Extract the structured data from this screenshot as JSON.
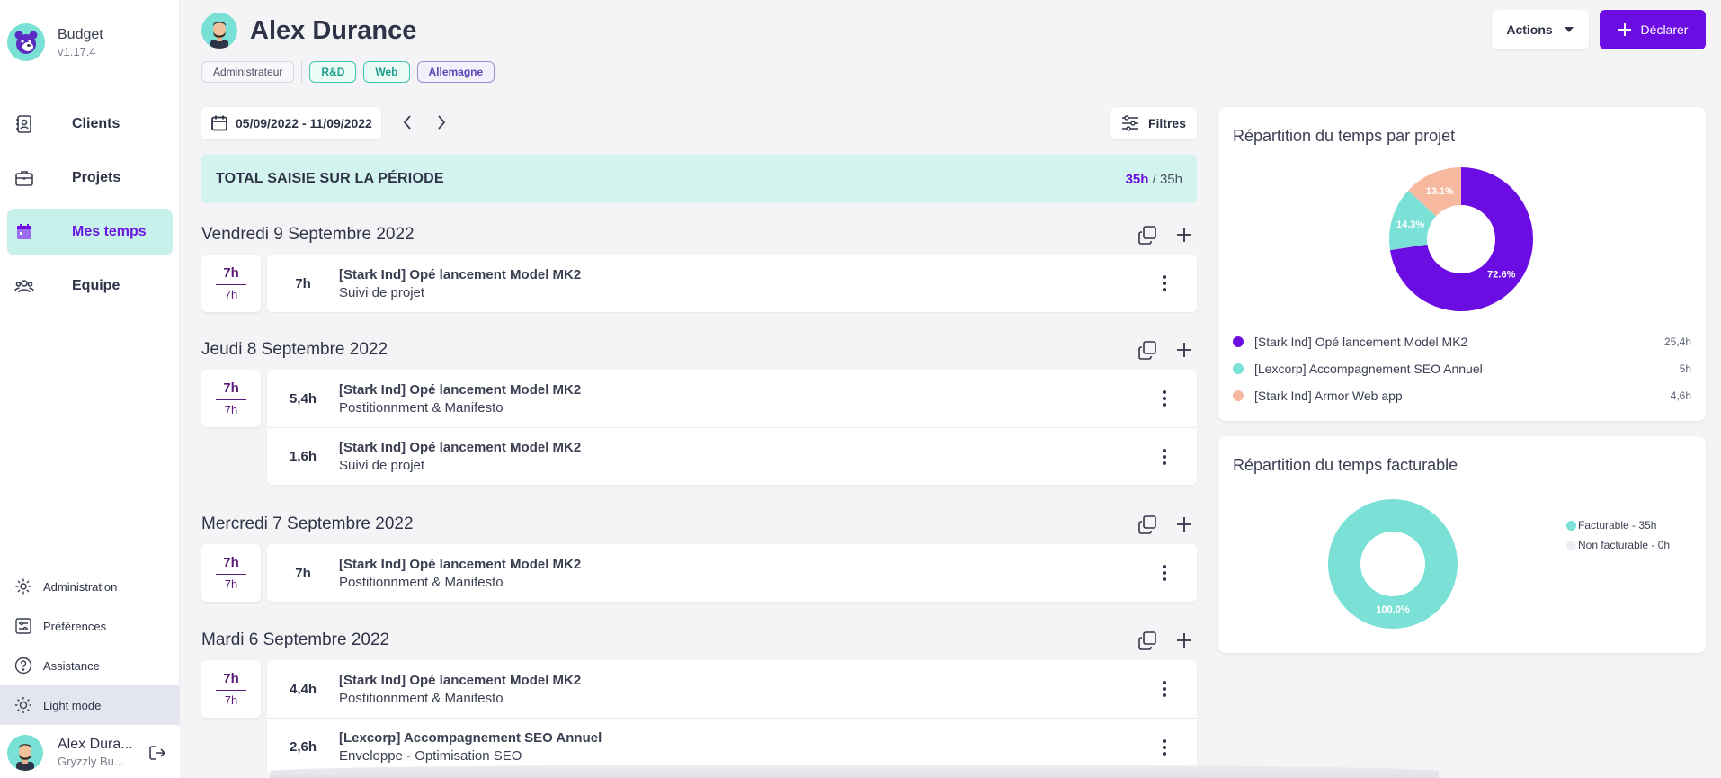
{
  "app": {
    "name": "Budget",
    "version": "v1.17.4"
  },
  "sidebar": {
    "items": [
      {
        "label": "Clients",
        "icon": "contacts-book-icon",
        "active": false
      },
      {
        "label": "Projets",
        "icon": "briefcase-icon",
        "active": false
      },
      {
        "label": "Mes temps",
        "icon": "calendar-icon",
        "active": true
      },
      {
        "label": "Equipe",
        "icon": "team-icon",
        "active": false
      }
    ],
    "bottom": [
      {
        "label": "Administration",
        "icon": "gear-icon"
      },
      {
        "label": "Préférences",
        "icon": "sliders-icon"
      },
      {
        "label": "Assistance",
        "icon": "help-circle-icon"
      },
      {
        "label": "Light mode",
        "icon": "sun-icon"
      }
    ],
    "user": {
      "name": "Alex Dura...",
      "company": "Gryzzly Bu..."
    }
  },
  "header": {
    "title": "Alex Durance",
    "role": "Administrateur",
    "tags": [
      "R&D",
      "Web",
      "Allemagne"
    ],
    "actions_label": "Actions",
    "declare_label": "Déclarer"
  },
  "toolbar": {
    "date_range": "05/09/2022 - 11/09/2022",
    "filters_label": "Filtres"
  },
  "total": {
    "label": "TOTAL SAISIE SUR LA PÉRIODE",
    "value": "35h",
    "target": "/ 35h"
  },
  "days": [
    {
      "title": "Vendredi 9 Septembre 2022",
      "total": "7h",
      "target": "7h",
      "entries": [
        {
          "hours": "7h",
          "project": "[Stark Ind] Opé lancement Model MK2",
          "task": "Suivi de projet"
        }
      ]
    },
    {
      "title": "Jeudi 8 Septembre 2022",
      "total": "7h",
      "target": "7h",
      "entries": [
        {
          "hours": "5,4h",
          "project": "[Stark Ind] Opé lancement Model MK2",
          "task": "Postitionnment & Manifesto"
        },
        {
          "hours": "1,6h",
          "project": "[Stark Ind] Opé lancement Model MK2",
          "task": "Suivi de projet"
        }
      ]
    },
    {
      "title": "Mercredi 7 Septembre 2022",
      "total": "7h",
      "target": "7h",
      "entries": [
        {
          "hours": "7h",
          "project": "[Stark Ind] Opé lancement Model MK2",
          "task": "Postitionnment & Manifesto"
        }
      ]
    },
    {
      "title": "Mardi 6 Septembre 2022",
      "total": "7h",
      "target": "7h",
      "entries": [
        {
          "hours": "4,4h",
          "project": "[Stark Ind] Opé lancement Model MK2",
          "task": "Postitionnment & Manifesto"
        },
        {
          "hours": "2,6h",
          "project": "[Lexcorp] Accompagnement SEO Annuel",
          "task": "Enveloppe - Optimisation SEO"
        }
      ]
    }
  ],
  "colors": {
    "accent": "#6b0de2",
    "teal": "#7be0d5",
    "peach": "#f7b8a0",
    "active_bg": "#c8f1ec"
  },
  "chart_data": [
    {
      "type": "pie",
      "title": "Répartition du temps par projet",
      "categories": [
        "[Stark Ind] Opé lancement Model MK2",
        "[Lexcorp] Accompagnement SEO Annuel",
        "[Stark Ind] Armor Web app"
      ],
      "values": [
        25.4,
        5,
        4.6
      ],
      "value_labels": [
        "25,4h",
        "5h",
        "4,6h"
      ],
      "slice_labels": [
        "72.6%",
        "14.3%",
        "13.1%"
      ],
      "colors": [
        "#6b0de2",
        "#7be0d5",
        "#f7b8a0"
      ],
      "legend": "bottom"
    },
    {
      "type": "pie",
      "title": "Répartition du temps facturable",
      "categories": [
        "Facturable - 35h",
        "Non facturable - 0h"
      ],
      "values": [
        35,
        0
      ],
      "slice_labels": [
        "100.0%"
      ],
      "colors": [
        "#7be0d5",
        "#eeeef2"
      ],
      "legend": "right"
    }
  ]
}
